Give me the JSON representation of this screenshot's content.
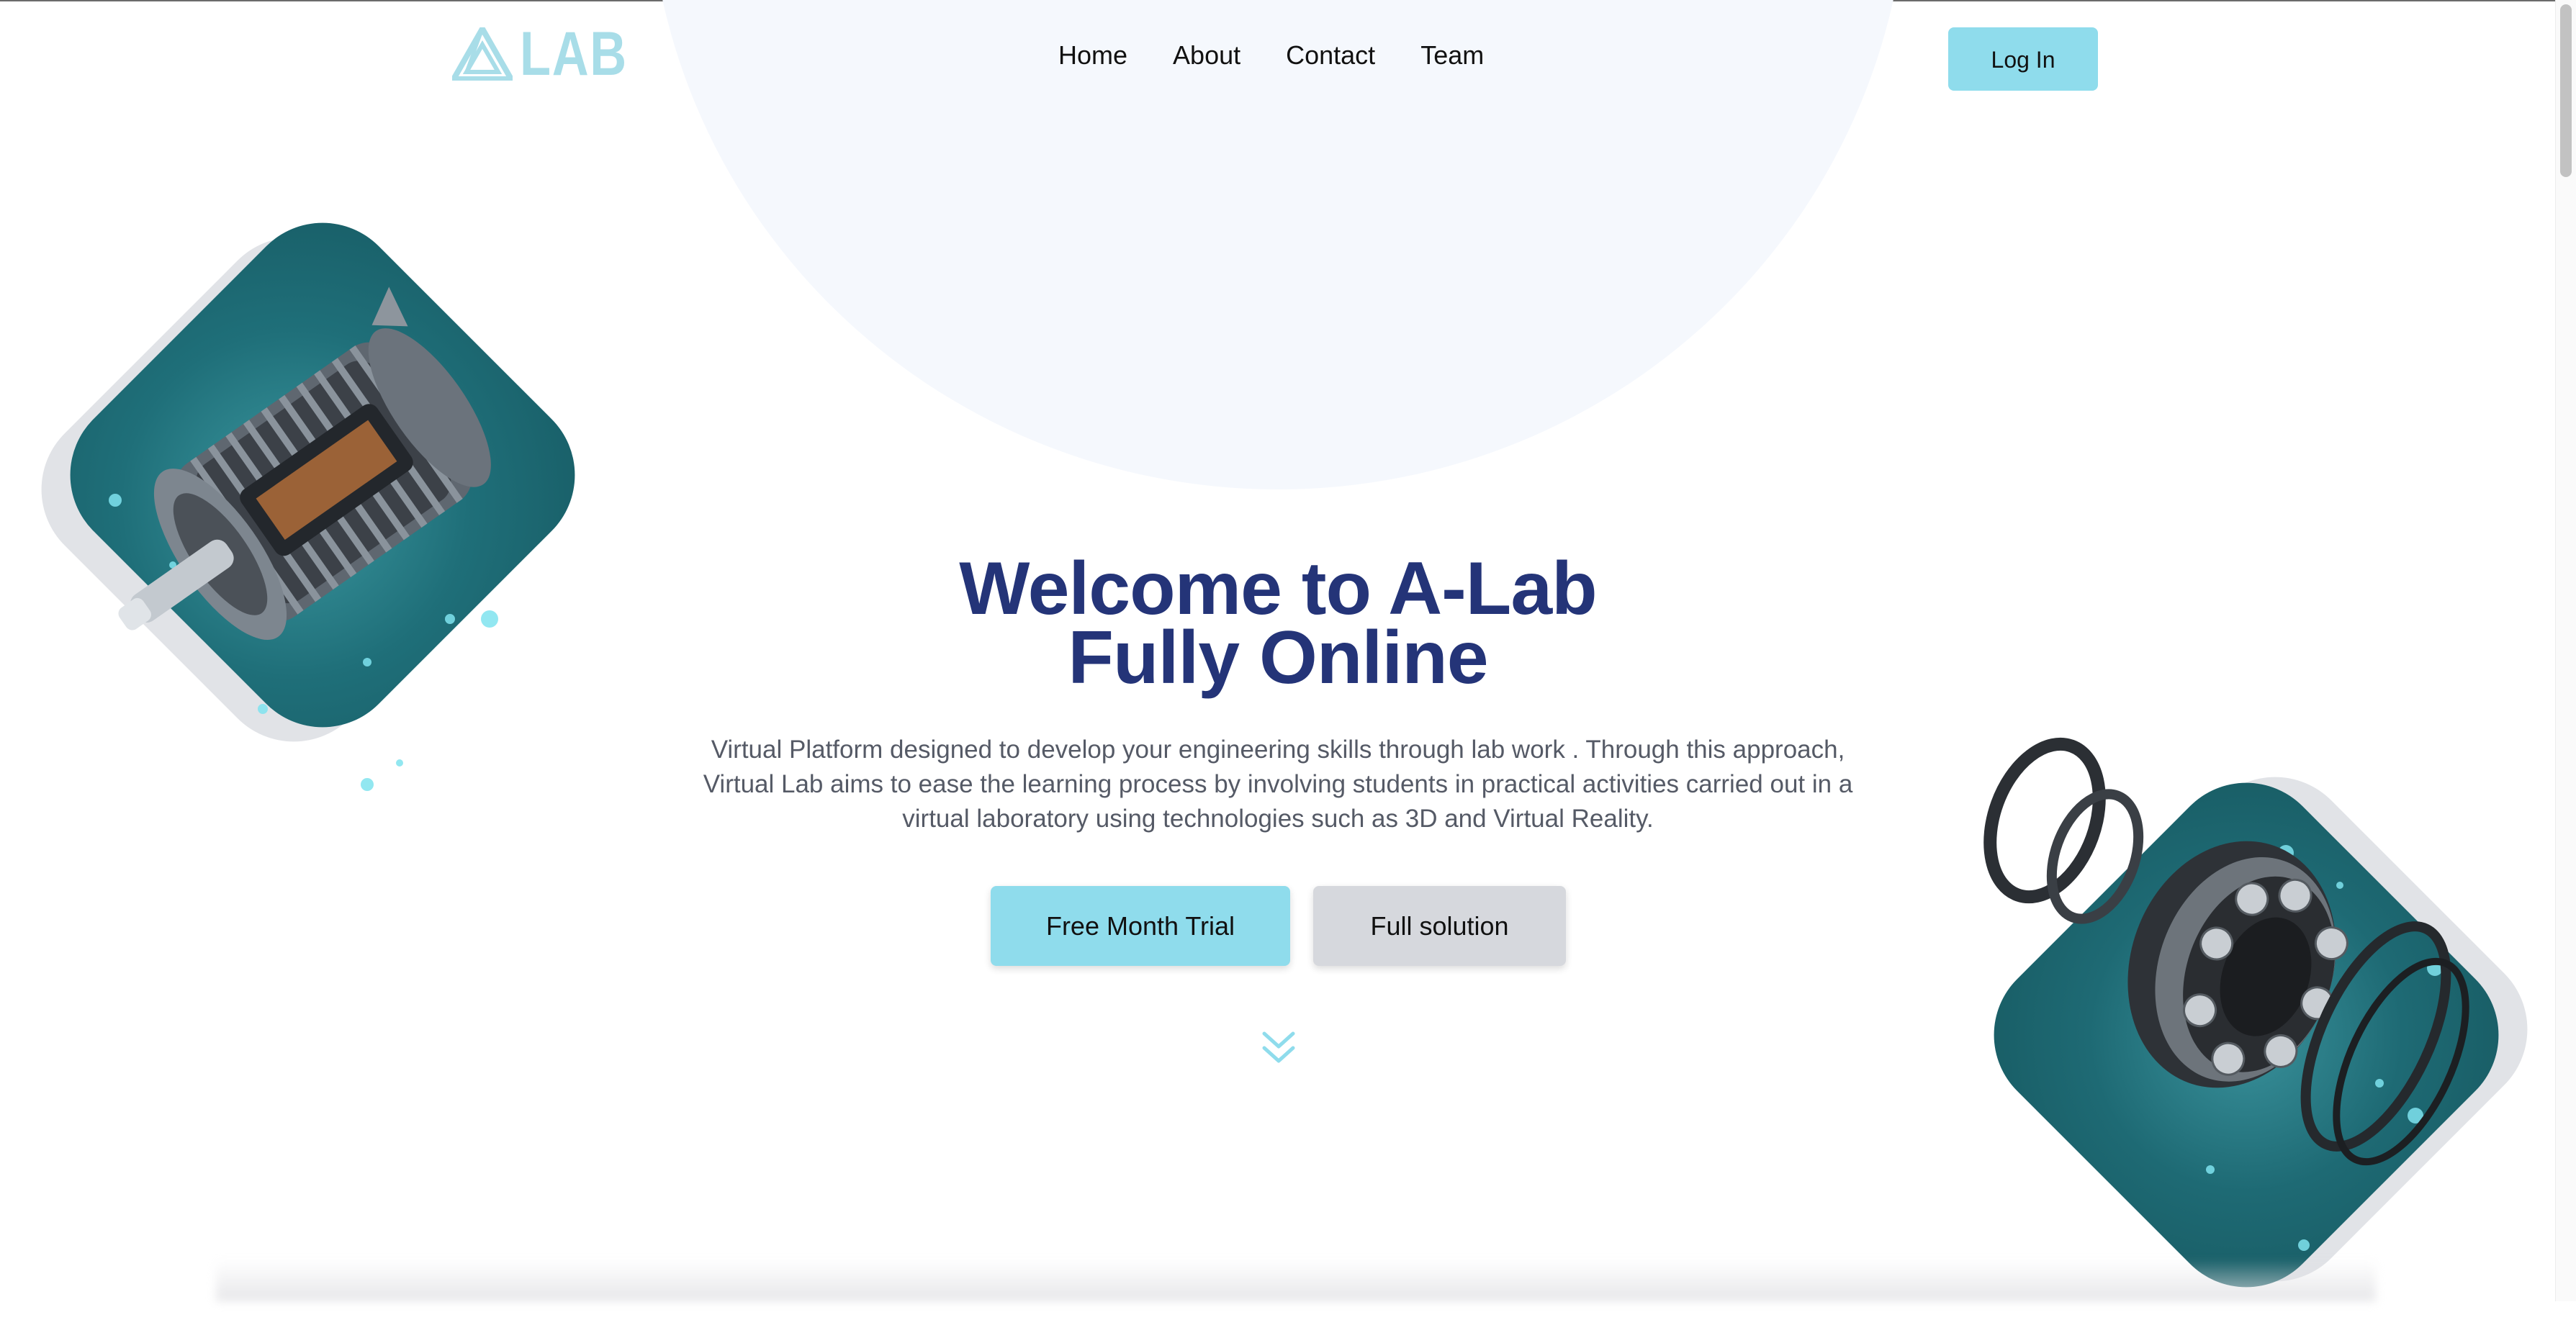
{
  "brand": {
    "logo_text": "LAB",
    "logo_color": "#a8dde8"
  },
  "nav": {
    "items": [
      {
        "label": "Home"
      },
      {
        "label": "About"
      },
      {
        "label": "Contact"
      },
      {
        "label": "Team"
      }
    ],
    "login_label": "Log In"
  },
  "hero": {
    "title_line1": "Welcome to A-Lab",
    "title_line2": "Fully Online",
    "description": "Virtual Platform designed to develop your engineering skills through lab work . Through this approach, Virtual Lab aims to ease the learning process by involving students in practical activities carried out in a virtual laboratory using technologies such as 3D and Virtual Reality.",
    "primary_cta": "Free Month Trial",
    "secondary_cta": "Full solution"
  },
  "icons": {
    "logo": "triangle-logo-icon",
    "scroll": "double-chevron-down-icon"
  },
  "colors": {
    "accent": "#8fdcec",
    "title": "#243478",
    "secondary_button": "#d6d8dd",
    "card_teal": "#1f6f79"
  }
}
